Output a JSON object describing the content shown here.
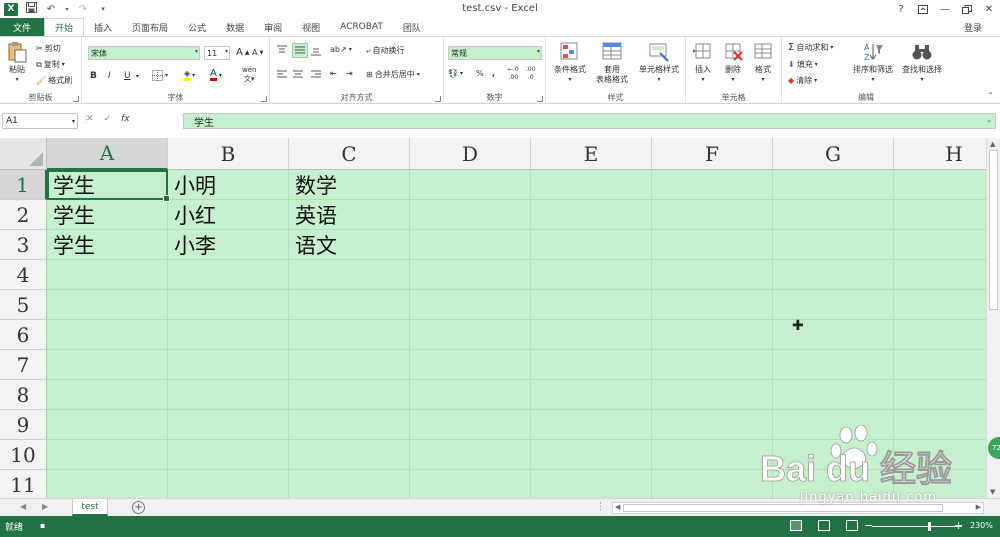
{
  "window": {
    "title": "test.csv - Excel",
    "login": "登录",
    "help": "?"
  },
  "tabs": [
    "文件",
    "开始",
    "插入",
    "页面布局",
    "公式",
    "数据",
    "审阅",
    "视图",
    "ACROBAT",
    "团队"
  ],
  "active_tab": "开始",
  "ribbon": {
    "clipboard": {
      "label": "剪贴板",
      "paste": "粘贴",
      "cut": "剪切",
      "copy": "复制",
      "format_painter": "格式刷"
    },
    "font": {
      "label": "字体",
      "name": "宋体",
      "size": "11",
      "bold": "B",
      "italic": "I",
      "underline": "U",
      "grow": "A",
      "shrink": "A",
      "font_color_glyph": "A",
      "phonetic": "wén"
    },
    "alignment": {
      "label": "对齐方式",
      "wrap": "自动换行",
      "merge": "合并后居中"
    },
    "number": {
      "label": "数字",
      "format": "常规",
      "percent": "%",
      "comma": ",",
      "inc": ".00",
      "dec": ".0"
    },
    "styles": {
      "label": "样式",
      "conditional": "条件格式",
      "table_line1": "套用",
      "table_line2": "表格格式",
      "cell_styles": "单元格样式"
    },
    "cells": {
      "label": "单元格",
      "insert": "插入",
      "delete": "删除",
      "format": "格式"
    },
    "editing": {
      "label": "编辑",
      "autosum": "自动求和",
      "fill": "填充",
      "clear": "清除",
      "sort": "排序和筛选",
      "find": "查找和选择"
    }
  },
  "formula_bar": {
    "name_box": "A1",
    "fx": "fx",
    "value": "学生"
  },
  "sheet": {
    "columns": [
      "A",
      "B",
      "C",
      "D",
      "E",
      "F",
      "G",
      "H"
    ],
    "rows": [
      "1",
      "2",
      "3",
      "4",
      "5",
      "6",
      "7",
      "8",
      "9",
      "10",
      "11"
    ],
    "cells": [
      [
        "学生",
        "小明",
        "数学"
      ],
      [
        "学生",
        "小红",
        "英语"
      ],
      [
        "学生",
        "小李",
        "语文"
      ]
    ],
    "selected_cell": "A1",
    "fill_color": "#c6efce"
  },
  "sheet_tabs": {
    "tabs": [
      "test"
    ],
    "active": "test"
  },
  "status": {
    "text": "就绪",
    "zoom": "230%"
  },
  "watermark": {
    "brand": "Bai du 经验",
    "url": "jingyan.baidu.com"
  },
  "overlay_badge": "72",
  "accent_color": "#217346"
}
